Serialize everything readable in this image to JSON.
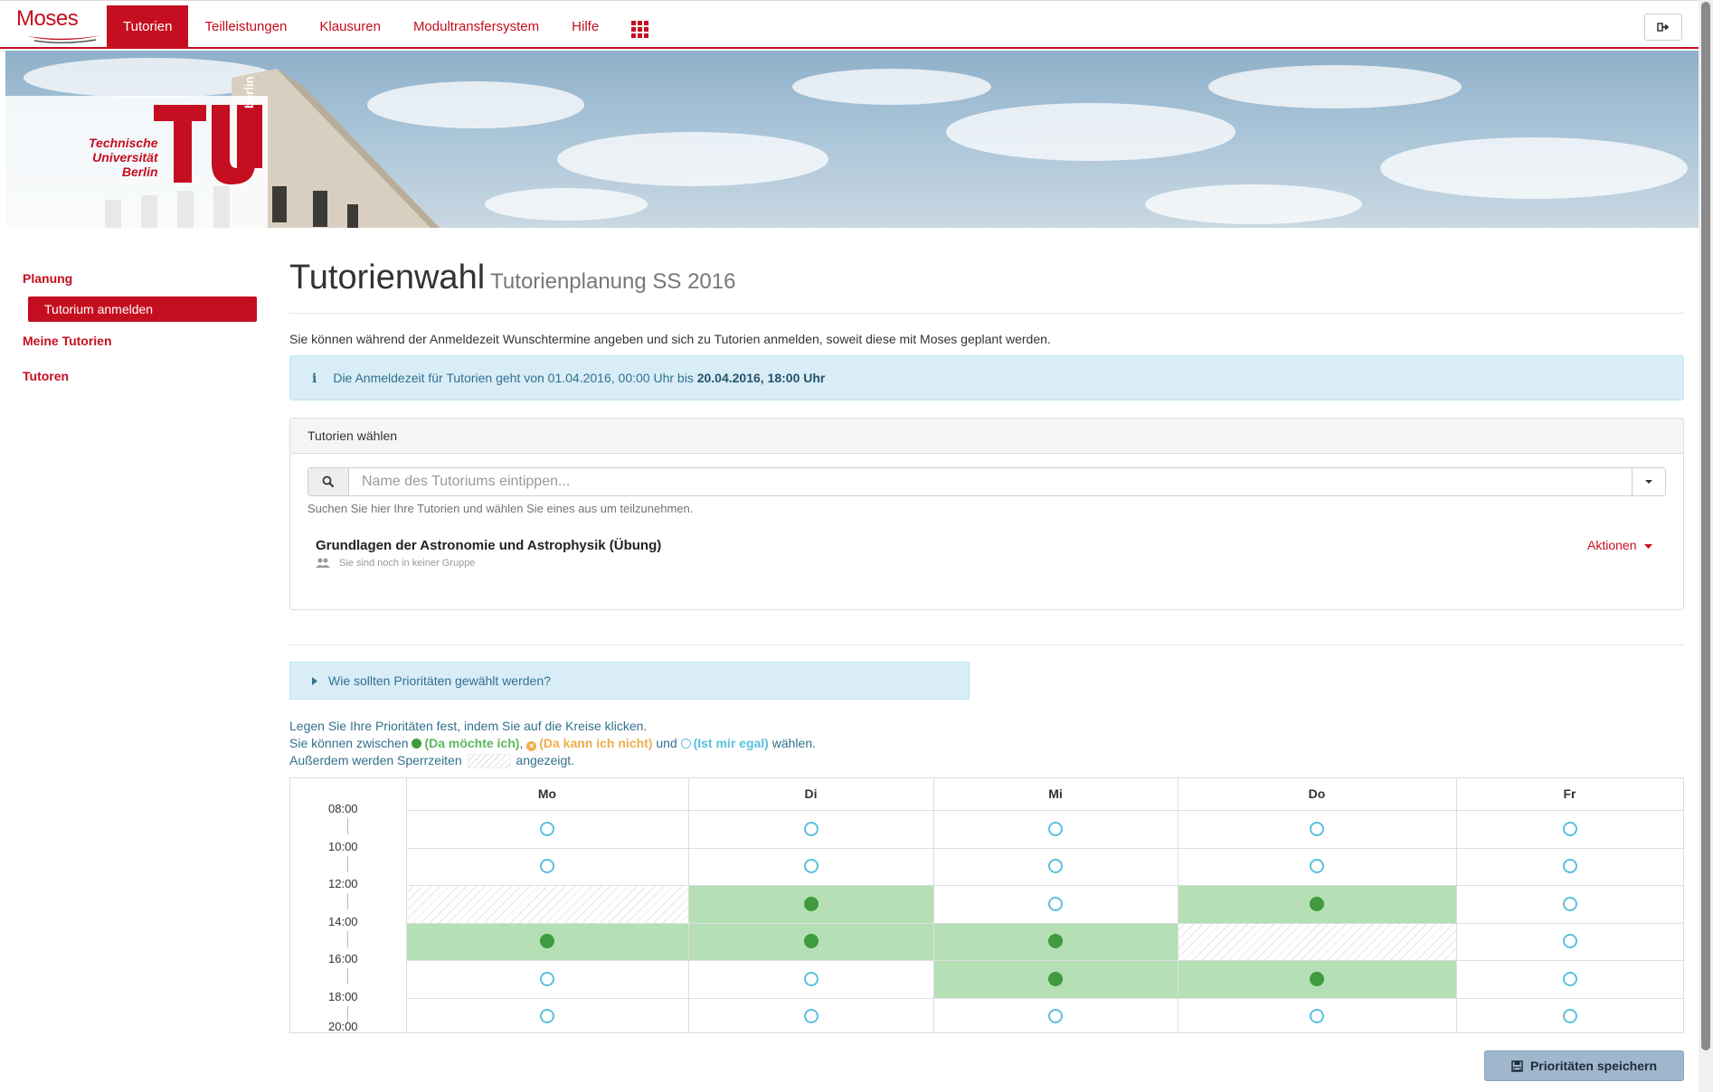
{
  "app": {
    "logo": "Moses"
  },
  "nav": {
    "items": [
      {
        "label": "Tutorien",
        "active": true
      },
      {
        "label": "Teilleistungen",
        "active": false
      },
      {
        "label": "Klausuren",
        "active": false
      },
      {
        "label": "Modultransfersystem",
        "active": false
      },
      {
        "label": "Hilfe",
        "active": false
      }
    ],
    "apps_icon": "grid-icon",
    "logout_icon": "sign-out-icon"
  },
  "banner": {
    "tu_lines": [
      "Technische",
      "Universität",
      "Berlin"
    ],
    "tu_vertical": "berlin"
  },
  "sidebar": {
    "planung": "Planung",
    "tutorium_anmelden": "Tutorium anmelden",
    "meine_tutorien": "Meine Tutorien",
    "tutoren": "Tutoren"
  },
  "main": {
    "title": "Tutorienwahl",
    "subtitle": "Tutorienplanung SS 2016",
    "intro": "Sie können während der Anmeldezeit Wunschtermine angeben und sich zu Tutorien anmelden, soweit diese mit Moses geplant werden.",
    "alert": {
      "prefix": "Die Anmeldezeit für Tutorien geht von 01.04.2016, 00:00 Uhr bis ",
      "bold": "20.04.2016, 18:00 Uhr"
    },
    "panel": {
      "heading": "Tutorien wählen",
      "search_placeholder": "Name des Tutoriums eintippen...",
      "search_help": "Suchen Sie hier Ihre Tutorien und wählen Sie eines aus um teilzunehmen.",
      "course_title": "Grundlagen der Astronomie und Astrophysik (Übung)",
      "course_status": "Sie sind noch in keiner Gruppe",
      "actions": "Aktionen"
    },
    "collapse": "Wie sollten Prioritäten gewählt werden?",
    "legend": {
      "line1": "Legen Sie Ihre Prioritäten fest, indem Sie auf die Kreise klicken.",
      "line2_a": "Sie können zwischen ",
      "green": "(Da möchte ich)",
      "comma": ", ",
      "orange": "(Da kann ich nicht)",
      "und": " und ",
      "blue": "(Ist mir egal)",
      "line2_end": " wählen.",
      "line3_a": "Außerdem werden Sperrzeiten ",
      "line3_b": " angezeigt."
    },
    "schedule": {
      "days": [
        "Mo",
        "Di",
        "Mi",
        "Do",
        "Fr"
      ],
      "times": [
        "08:00",
        "10:00",
        "12:00",
        "14:00",
        "16:00",
        "18:00",
        "20:00"
      ],
      "grid": [
        [
          "empty",
          "empty",
          "empty",
          "empty",
          "empty"
        ],
        [
          "empty",
          "empty",
          "empty",
          "empty",
          "empty"
        ],
        [
          "blocked",
          "wanted",
          "empty",
          "wanted",
          "empty"
        ],
        [
          "wanted",
          "wanted",
          "wanted",
          "blocked",
          "empty"
        ],
        [
          "empty",
          "empty",
          "wanted",
          "wanted",
          "empty"
        ],
        [
          "empty",
          "empty",
          "empty",
          "empty",
          "empty"
        ]
      ]
    },
    "save_button": "Prioritäten speichern"
  }
}
